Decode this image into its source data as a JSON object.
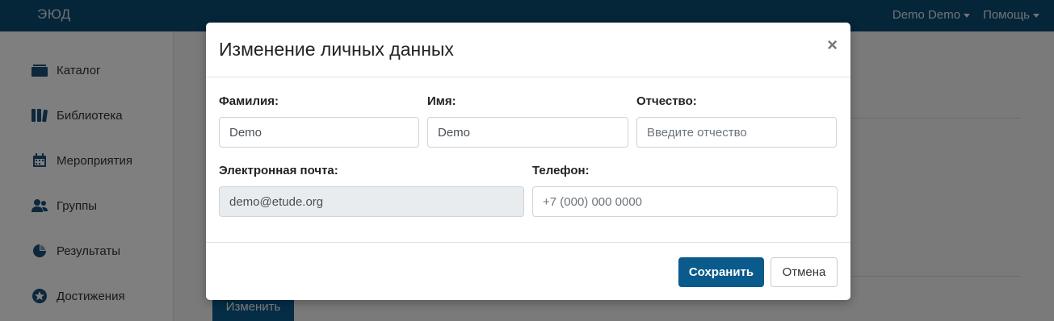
{
  "app": {
    "logo": "ЭЮД",
    "user_menu": "Demo Demo",
    "help_menu": "Помощь"
  },
  "sidebar": {
    "items": [
      {
        "label": "Каталог",
        "icon": "catalog-icon"
      },
      {
        "label": "Библиотека",
        "icon": "library-icon"
      },
      {
        "label": "Мероприятия",
        "icon": "calendar-icon"
      },
      {
        "label": "Группы",
        "icon": "users-icon"
      },
      {
        "label": "Результаты",
        "icon": "pie-chart-icon"
      },
      {
        "label": "Достижения",
        "icon": "star-icon"
      }
    ]
  },
  "background": {
    "edit_button": "Изменить"
  },
  "modal": {
    "title": "Изменение личных данных",
    "close_symbol": "×",
    "fields": {
      "last_name": {
        "label": "Фамилия:",
        "value": "Demo",
        "placeholder": ""
      },
      "first_name": {
        "label": "Имя:",
        "value": "Demo",
        "placeholder": ""
      },
      "middle_name": {
        "label": "Отчество:",
        "value": "",
        "placeholder": "Введите отчество"
      },
      "email": {
        "label": "Электронная почта:",
        "value": "demo@etude.org",
        "placeholder": ""
      },
      "phone": {
        "label": "Телефон:",
        "value": "",
        "placeholder": "+7 (000) 000 0000"
      }
    },
    "save_label": "Сохранить",
    "cancel_label": "Отмена"
  },
  "colors": {
    "navbar": "#0a4b73",
    "primary_button": "#0b5a8c",
    "sidebar_icon": "#1a4f78"
  }
}
